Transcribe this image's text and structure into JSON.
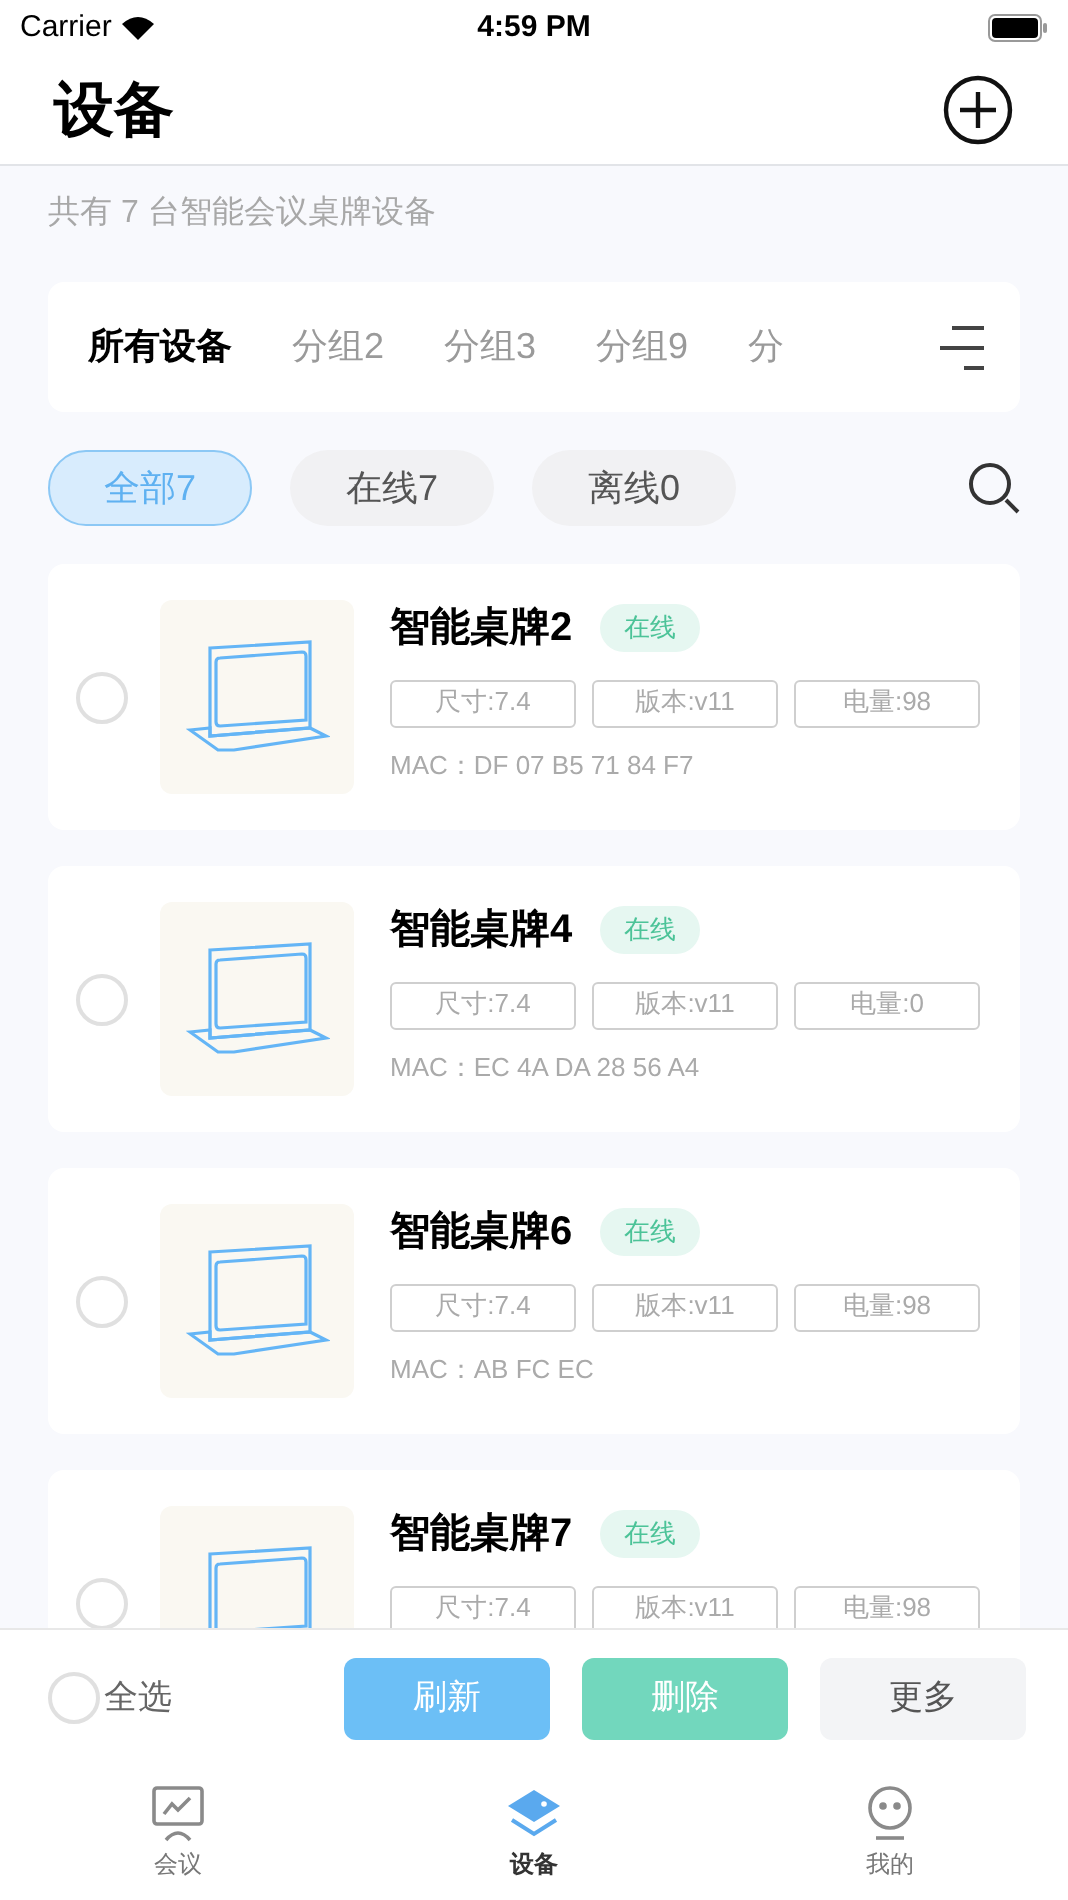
{
  "status_bar": {
    "carrier": "Carrier",
    "time": "4:59 PM"
  },
  "header": {
    "title": "设备"
  },
  "summary": "共有 7 台智能会议桌牌设备",
  "group_tabs": [
    {
      "label": "所有设备",
      "selected": true
    },
    {
      "label": "分组2",
      "selected": false
    },
    {
      "label": "分组3",
      "selected": false
    },
    {
      "label": "分组9",
      "selected": false
    },
    {
      "label": "分",
      "selected": false
    }
  ],
  "filters": [
    {
      "label": "全部7",
      "selected": true
    },
    {
      "label": "在线7",
      "selected": false
    },
    {
      "label": "离线0",
      "selected": false
    }
  ],
  "devices": [
    {
      "name": "智能桌牌2",
      "status": "在线",
      "online": true,
      "checked": false,
      "tags": [
        "尺寸:7.4",
        "版本:v11",
        "电量:98"
      ],
      "mac": "MAC：DF 07 B5 71 84 F7"
    },
    {
      "name": "智能桌牌4",
      "status": "在线",
      "online": true,
      "checked": false,
      "tags": [
        "尺寸:7.4",
        "版本:v11",
        "电量:0"
      ],
      "mac": "MAC：EC 4A DA 28 56 A4"
    },
    {
      "name": "智能桌牌6",
      "status": "在线",
      "online": true,
      "checked": false,
      "tags": [
        "尺寸:7.4",
        "版本:v11",
        "电量:98"
      ],
      "mac": "MAC：AB FC EC"
    },
    {
      "name": "智能桌牌7",
      "status": "在线",
      "online": true,
      "checked": false,
      "tags": [
        "尺寸:7.4",
        "版本:v11",
        "电量:98"
      ]
    }
  ],
  "action_bar": {
    "select_all": {
      "label": "全选",
      "checked": false
    },
    "buttons": [
      {
        "label": "刷新",
        "kind": "refresh"
      },
      {
        "label": "删除",
        "kind": "delete"
      },
      {
        "label": "更多",
        "kind": "more"
      }
    ]
  },
  "bottom_nav": [
    {
      "label": "会议",
      "kind": "meeting",
      "selected": false
    },
    {
      "label": "设备",
      "kind": "device",
      "selected": true
    },
    {
      "label": "我的",
      "kind": "profile",
      "selected": false
    }
  ]
}
